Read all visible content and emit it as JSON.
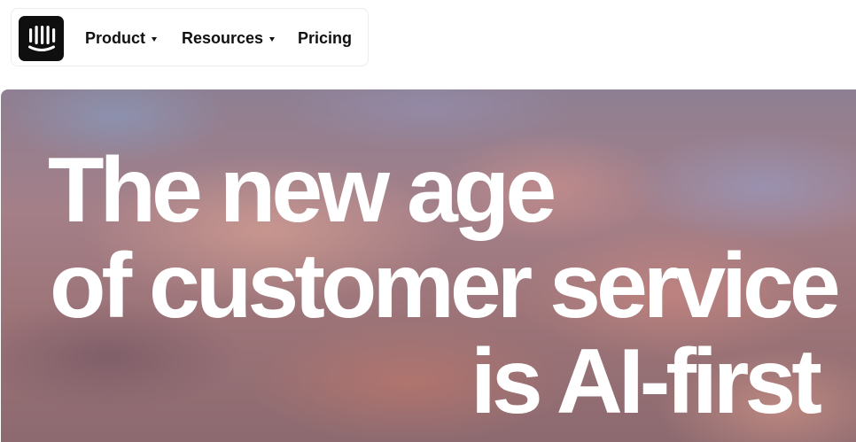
{
  "nav": {
    "logo_icon": "intercom-logo-icon",
    "items": [
      {
        "label": "Product",
        "has_dropdown": true
      },
      {
        "label": "Resources",
        "has_dropdown": true
      },
      {
        "label": "Pricing",
        "has_dropdown": false
      }
    ]
  },
  "hero": {
    "title_lines": [
      "The new age",
      "of customer service",
      "is AI-first"
    ]
  }
}
